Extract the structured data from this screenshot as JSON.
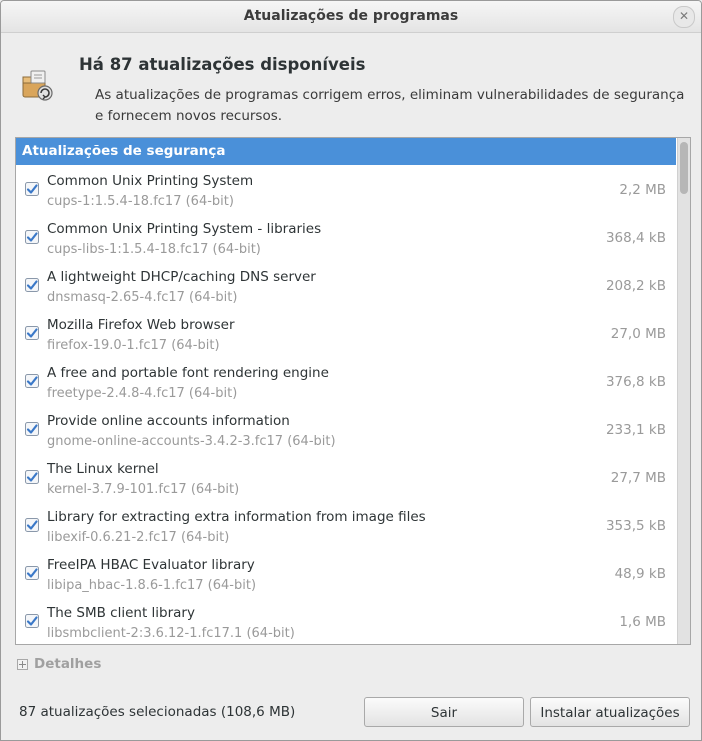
{
  "window": {
    "title": "Atualizações de programas",
    "close_symbol": "✕"
  },
  "header": {
    "icon": "package-updates-icon",
    "heading": "Há 87 atualizações disponíveis",
    "description": "As atualizações de programas corrigem erros, eliminam vulnerabilidades de segurança e fornecem novos recursos."
  },
  "list": {
    "section_title": "Atualizações de segurança",
    "items": [
      {
        "name": "Common Unix Printing System",
        "package": "cups-1:1.5.4-18.fc17 (64-bit)",
        "size": "2,2 MB",
        "checked": true
      },
      {
        "name": "Common Unix Printing System - libraries",
        "package": "cups-libs-1:1.5.4-18.fc17 (64-bit)",
        "size": "368,4 kB",
        "checked": true
      },
      {
        "name": "A lightweight DHCP/caching DNS server",
        "package": "dnsmasq-2.65-4.fc17 (64-bit)",
        "size": "208,2 kB",
        "checked": true
      },
      {
        "name": "Mozilla Firefox Web browser",
        "package": "firefox-19.0-1.fc17 (64-bit)",
        "size": "27,0 MB",
        "checked": true
      },
      {
        "name": "A free and portable font rendering engine",
        "package": "freetype-2.4.8-4.fc17 (64-bit)",
        "size": "376,8 kB",
        "checked": true
      },
      {
        "name": "Provide online accounts information",
        "package": "gnome-online-accounts-3.4.2-3.fc17 (64-bit)",
        "size": "233,1 kB",
        "checked": true
      },
      {
        "name": "The Linux kernel",
        "package": "kernel-3.7.9-101.fc17 (64-bit)",
        "size": "27,7 MB",
        "checked": true
      },
      {
        "name": "Library for extracting extra information from image files",
        "package": "libexif-0.6.21-2.fc17 (64-bit)",
        "size": "353,5 kB",
        "checked": true
      },
      {
        "name": "FreeIPA HBAC Evaluator library",
        "package": "libipa_hbac-1.8.6-1.fc17 (64-bit)",
        "size": "48,9 kB",
        "checked": true
      },
      {
        "name": "The SMB client library",
        "package": "libsmbclient-2:3.6.12-1.fc17.1 (64-bit)",
        "size": "1,6 MB",
        "checked": true
      }
    ]
  },
  "details": {
    "label": "Detalhes"
  },
  "footer": {
    "status": "87 atualizações selecionadas (108,6 MB)",
    "exit_label": "Sair",
    "install_label": "Instalar atualizações"
  },
  "colors": {
    "selection": "#4a90d9",
    "checkbox": "#3a78c8"
  }
}
